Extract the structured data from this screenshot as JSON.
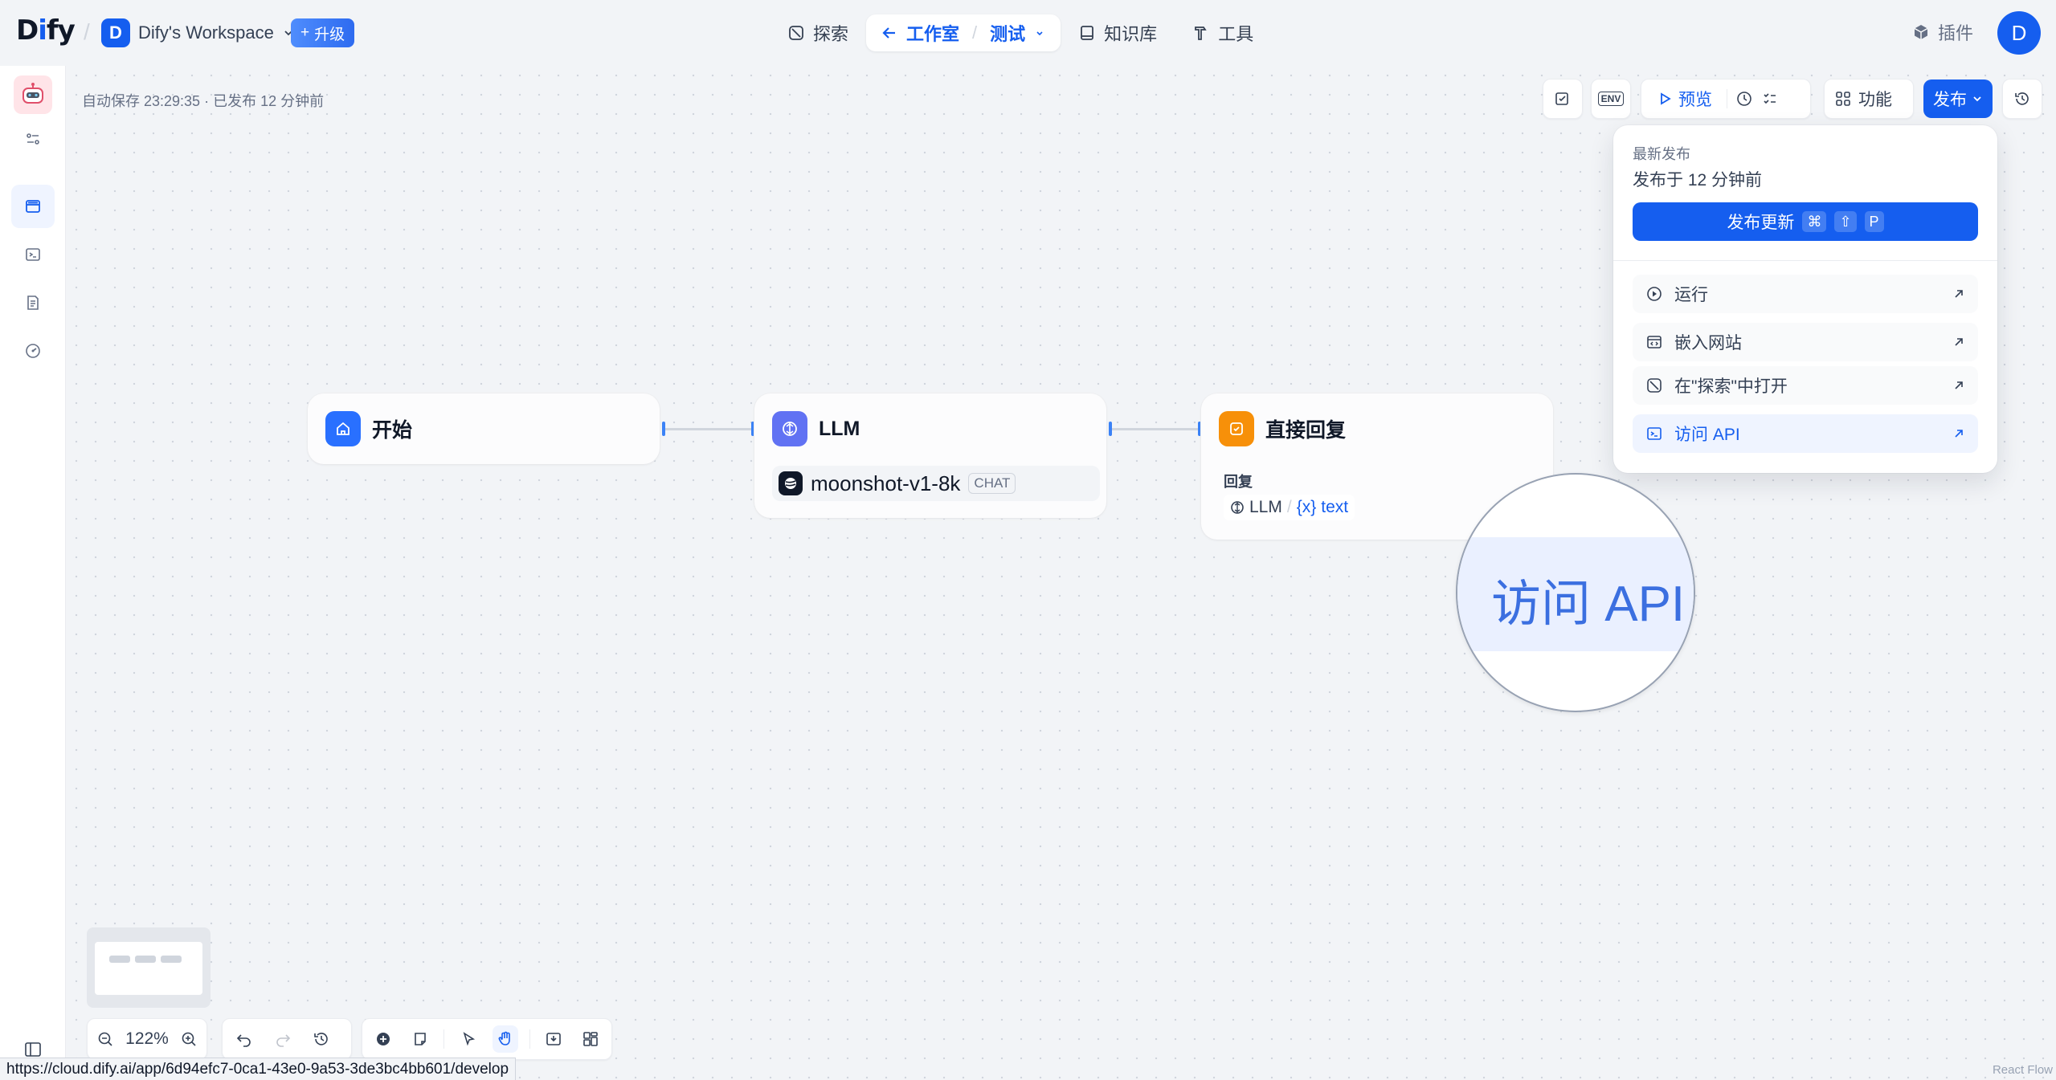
{
  "header": {
    "logo": {
      "part1": "D",
      "accent": "i",
      "part2": "fy"
    },
    "workspace": {
      "initial": "D",
      "name": "Dify's Workspace"
    },
    "upgrade_label": "升级",
    "nav": {
      "explore": "探索",
      "studio": "工作室",
      "app_name": "测试",
      "knowledge": "知识库",
      "tools": "工具"
    },
    "plugins_label": "插件",
    "user_initial": "D"
  },
  "toolbar": {
    "autosave": "自动保存 23:29:35 · 已发布 12 分钟前",
    "env_label": "ENV",
    "preview_label": "预览",
    "features_label": "功能",
    "publish_label": "发布"
  },
  "publish_menu": {
    "latest_label": "最新发布",
    "published_time": "发布于 12 分钟前",
    "update_label": "发布更新",
    "shortcut": [
      "⌘",
      "⇧",
      "P"
    ],
    "items": [
      {
        "label": "运行",
        "icon": "play-circle-icon"
      },
      {
        "label": "嵌入网站",
        "icon": "embed-icon"
      },
      {
        "label": "在\"探索\"中打开",
        "icon": "explore-icon"
      },
      {
        "label": "访问 API",
        "icon": "terminal-icon"
      }
    ]
  },
  "nodes": {
    "start": {
      "title": "开始"
    },
    "llm": {
      "title": "LLM",
      "model": "moonshot-v1-8k",
      "badge": "CHAT"
    },
    "answer": {
      "title": "直接回复",
      "reply_label": "回复",
      "source": "LLM",
      "var_prefix": "{x}",
      "var_name": "text"
    }
  },
  "magnifier": {
    "text": "访问 API"
  },
  "controls": {
    "zoom": "122%"
  },
  "status_bar": {
    "url": "https://cloud.dify.ai/app/6d94efc7-0ca1-43e0-9a53-3de3bc4bb601/develop"
  },
  "watermark": "React Flow",
  "colors": {
    "accent": "#155eef",
    "start_node": "#2970ff",
    "llm_node": "#6172f3",
    "answer_node": "#f79009"
  }
}
